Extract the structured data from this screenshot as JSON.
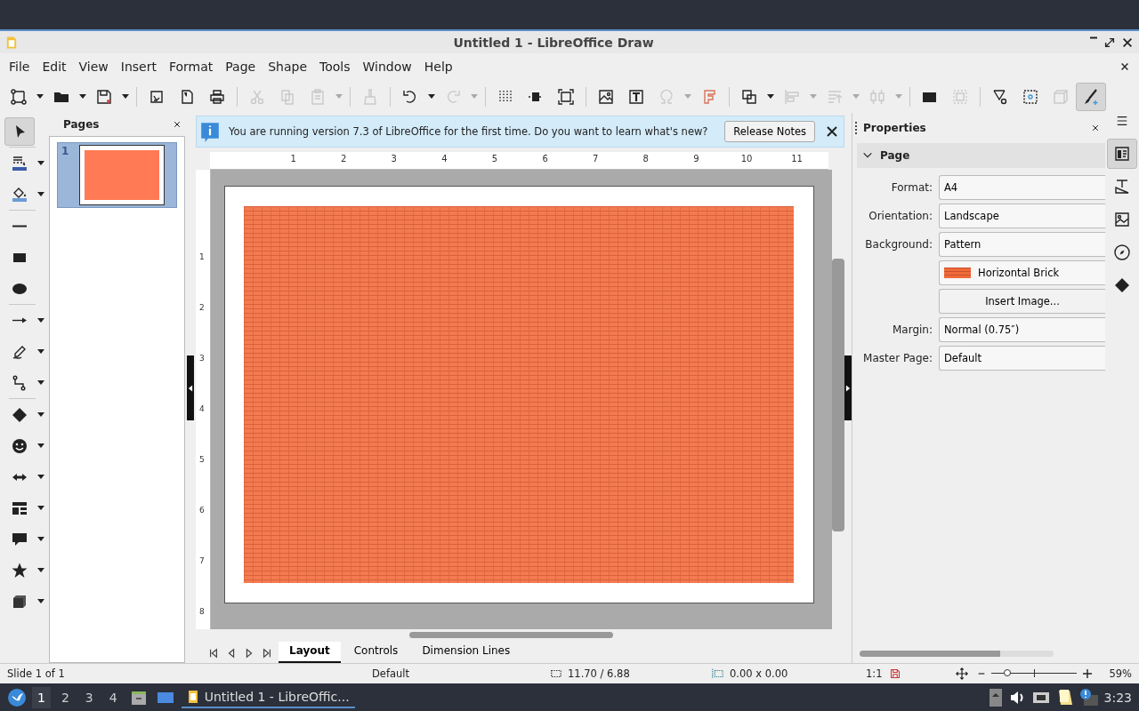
{
  "window": {
    "title": "Untitled 1 - LibreOffice Draw"
  },
  "menu": [
    "File",
    "Edit",
    "View",
    "Insert",
    "Format",
    "Page",
    "Shape",
    "Tools",
    "Window",
    "Help"
  ],
  "toolbar": [
    {
      "disabled": false,
      "selected": false
    },
    {
      "disabled": false,
      "selected": false
    },
    {
      "disabled": false,
      "selected": false
    },
    {
      "disabled": false,
      "selected": false
    },
    {
      "disabled": false,
      "selected": false
    },
    {
      "disabled": false,
      "selected": false
    },
    {
      "disabled": true,
      "selected": false
    },
    {
      "disabled": true,
      "selected": false
    },
    {
      "disabled": true,
      "selected": false
    },
    {
      "disabled": true,
      "selected": false
    },
    {
      "disabled": false,
      "selected": false
    },
    {
      "disabled": true,
      "selected": false
    },
    {
      "disabled": false,
      "selected": false
    },
    {
      "disabled": false,
      "selected": false
    },
    {
      "disabled": false,
      "selected": false
    },
    {
      "disabled": false,
      "selected": false
    },
    {
      "disabled": false,
      "selected": false
    },
    {
      "disabled": true,
      "selected": false
    },
    {
      "disabled": false,
      "selected": false
    },
    {
      "disabled": false,
      "selected": false
    },
    {
      "disabled": true,
      "selected": false
    },
    {
      "disabled": true,
      "selected": false
    },
    {
      "disabled": true,
      "selected": false
    },
    {
      "disabled": false,
      "selected": false
    },
    {
      "disabled": true,
      "selected": false
    },
    {
      "disabled": false,
      "selected": false
    },
    {
      "disabled": false,
      "selected": false
    },
    {
      "disabled": true,
      "selected": false
    },
    {
      "disabled": false,
      "selected": true
    }
  ],
  "drawing_toolbar": [
    {
      "selected": true
    },
    {
      "selected": false
    },
    {
      "selected": false
    },
    {
      "selected": false
    },
    {
      "selected": false
    },
    {
      "selected": false
    },
    {
      "selected": false
    },
    {
      "selected": false
    },
    {
      "selected": false
    },
    {
      "selected": false
    },
    {
      "selected": false
    },
    {
      "selected": false
    },
    {
      "selected": false
    },
    {
      "selected": false
    },
    {
      "selected": false
    },
    {
      "selected": false
    }
  ],
  "pages_panel": {
    "title": "Pages",
    "pages": [
      {
        "number": "1",
        "selected": true
      }
    ]
  },
  "infobar": {
    "message": "You are running version 7.3 of LibreOffice for the first time. Do you want to learn what's new?",
    "button": "Release Notes"
  },
  "ruler": {
    "horizontal": [
      "1",
      "2",
      "3",
      "4",
      "5",
      "6",
      "7",
      "8",
      "9",
      "10",
      "11"
    ],
    "vertical": [
      "1",
      "2",
      "3",
      "4",
      "5",
      "6",
      "7",
      "8"
    ]
  },
  "layer_tabs": [
    {
      "label": "Layout",
      "selected": true
    },
    {
      "label": "Controls",
      "selected": false
    },
    {
      "label": "Dimension Lines",
      "selected": false
    }
  ],
  "properties": {
    "title": "Properties",
    "section": "Page",
    "expanded": true,
    "fields": [
      {
        "kind": "select",
        "label": "Format:",
        "value": "A4"
      },
      {
        "kind": "select",
        "label": "Orientation:",
        "value": "Landscape"
      },
      {
        "kind": "select",
        "label": "Background:",
        "value": "Pattern"
      },
      {
        "kind": "swatch",
        "value": "Horizontal Brick"
      },
      {
        "kind": "button",
        "value": "Insert Image..."
      },
      {
        "kind": "select",
        "label": "Margin:",
        "value": "Normal (0.75″)"
      },
      {
        "kind": "select",
        "label": "Master Page:",
        "value": "Default"
      }
    ]
  },
  "sidebar_tabs": [
    {
      "selected": true
    },
    {
      "selected": false
    },
    {
      "selected": false
    },
    {
      "selected": false
    },
    {
      "selected": false
    }
  ],
  "status_bar": {
    "slide": "Slide 1 of 1",
    "master": "Default",
    "position": "11.70 / 6.88",
    "size": "0.00 x 0.00",
    "scale": "1:1",
    "zoom_slider": {
      "level": 0.18
    },
    "zoom": "59%"
  },
  "taskbar": {
    "workspaces": [
      {
        "label": "1",
        "selected": true
      },
      {
        "label": "2",
        "selected": false
      },
      {
        "label": "3",
        "selected": false
      },
      {
        "label": "4",
        "selected": false
      }
    ],
    "task": "Untitled 1 - LibreOffic...",
    "clock": "3:23"
  }
}
